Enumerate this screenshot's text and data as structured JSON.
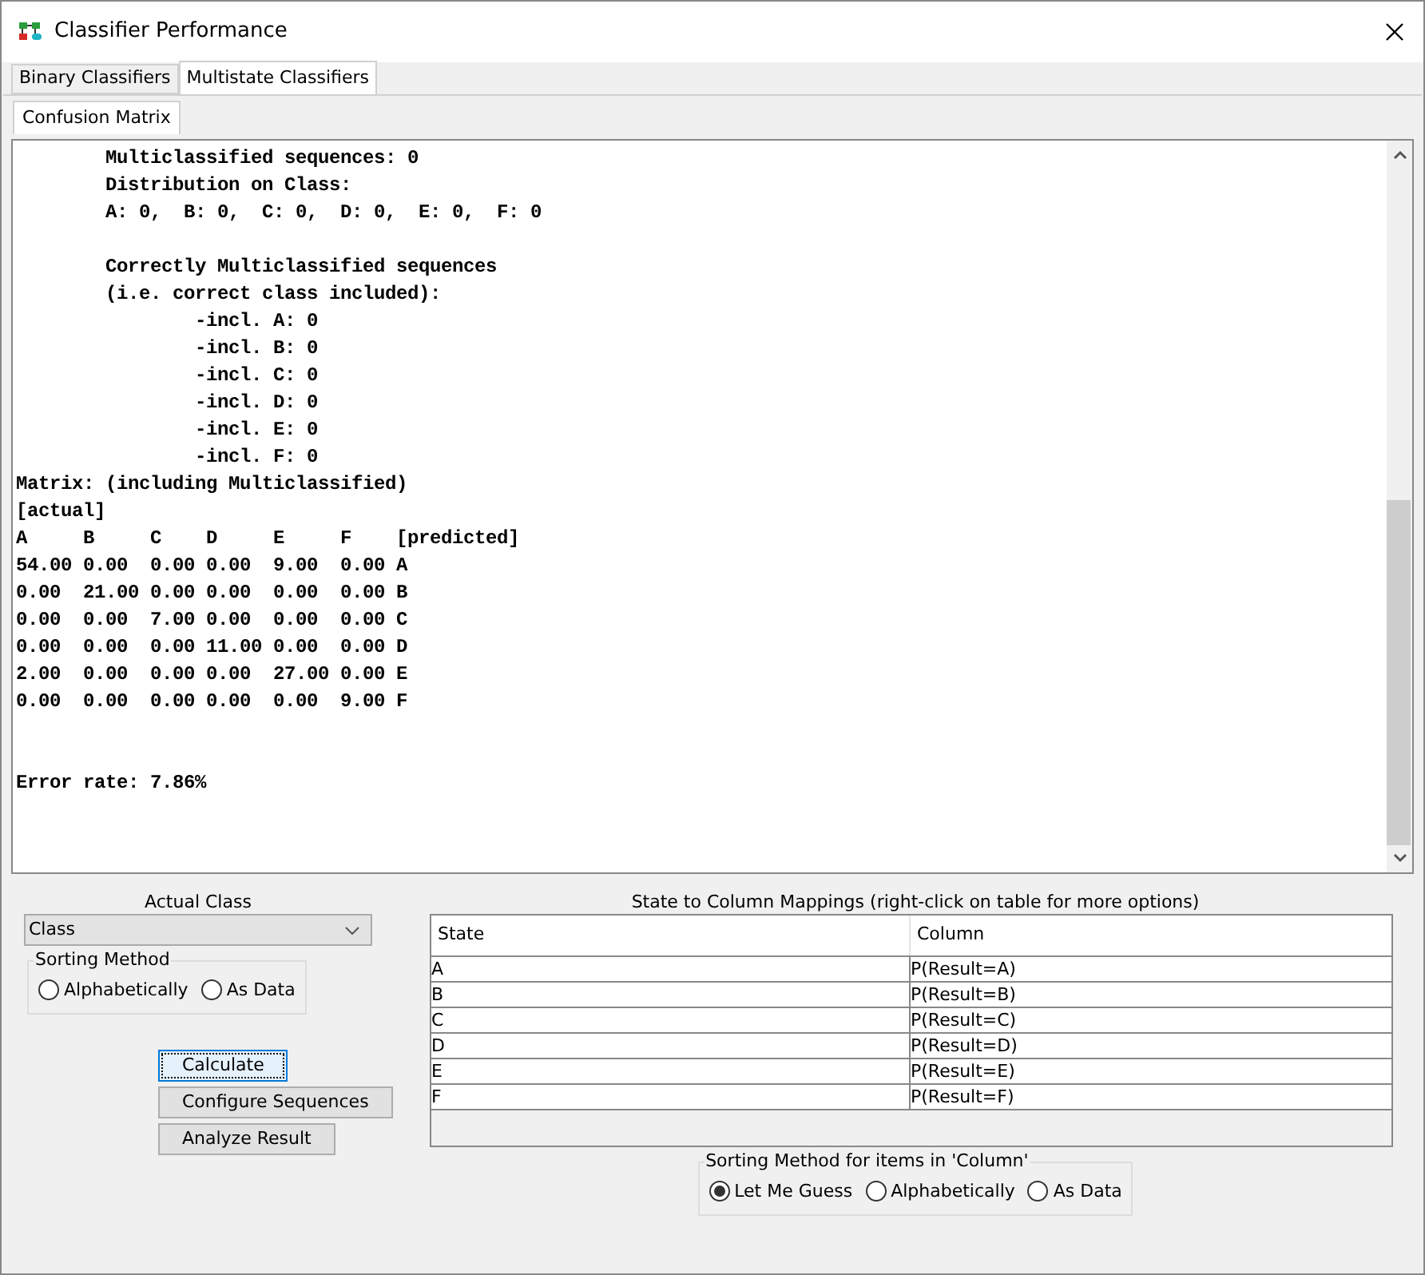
{
  "window": {
    "title": "Classifier Performance"
  },
  "tabs": [
    {
      "label": "Binary Classifiers",
      "selected": false
    },
    {
      "label": "Multistate Classifiers",
      "selected": true
    }
  ],
  "subtabs": [
    {
      "label": "Confusion Matrix",
      "selected": true
    }
  ],
  "report": {
    "sections": [
      {
        "lines": [
          "        Multiclassified sequences: 0",
          "        Distribution on Class:",
          "        A: 0,  B: 0,  C: 0,  D: 0,  E: 0,  F: 0"
        ]
      },
      {
        "lines": [
          "        Correctly Multiclassified sequences",
          "        (i.e. correct class included):",
          "                -incl. A: 0",
          "                -incl. B: 0",
          "                -incl. C: 0",
          "                -incl. D: 0",
          "                -incl. E: 0",
          "                -incl. F: 0",
          "Matrix: (including Multiclassified)",
          "[actual]",
          "A     B     C    D     E     F    [predicted]",
          "54.00 0.00  0.00 0.00  9.00  0.00 A",
          "0.00  21.00 0.00 0.00  0.00  0.00 B",
          "0.00  0.00  7.00 0.00  0.00  0.00 C",
          "0.00  0.00  0.00 11.00 0.00  0.00 D",
          "2.00  0.00  0.00 0.00  27.00 0.00 E",
          "0.00  0.00  0.00 0.00  0.00  9.00 F"
        ]
      }
    ],
    "error_rate": "Error rate: 7.86%"
  },
  "actual_class": {
    "label": "Actual Class",
    "value": "Class",
    "sorting": {
      "title": "Sorting Method",
      "options": [
        {
          "label": "Alphabetically",
          "selected": false
        },
        {
          "label": "As Data",
          "selected": false
        }
      ]
    }
  },
  "buttons": [
    {
      "label": "Calculate",
      "focused": true
    },
    {
      "label": "Configure Sequences",
      "focused": false
    },
    {
      "label": "Analyze Result",
      "focused": false
    }
  ],
  "mappings": {
    "title": "State to Column Mappings (right-click on table for more options)",
    "columns": [
      "State",
      "Column"
    ],
    "rows": [
      [
        "A",
        "P(Result=A)"
      ],
      [
        "B",
        "P(Result=B)"
      ],
      [
        "C",
        "P(Result=C)"
      ],
      [
        "D",
        "P(Result=D)"
      ],
      [
        "E",
        "P(Result=E)"
      ],
      [
        "F",
        "P(Result=F)"
      ]
    ],
    "sorting": {
      "title": "Sorting Method for items in 'Column'",
      "options": [
        {
          "label": "Let Me Guess",
          "selected": true
        },
        {
          "label": "Alphabetically",
          "selected": false
        },
        {
          "label": "As Data",
          "selected": false
        }
      ]
    }
  }
}
